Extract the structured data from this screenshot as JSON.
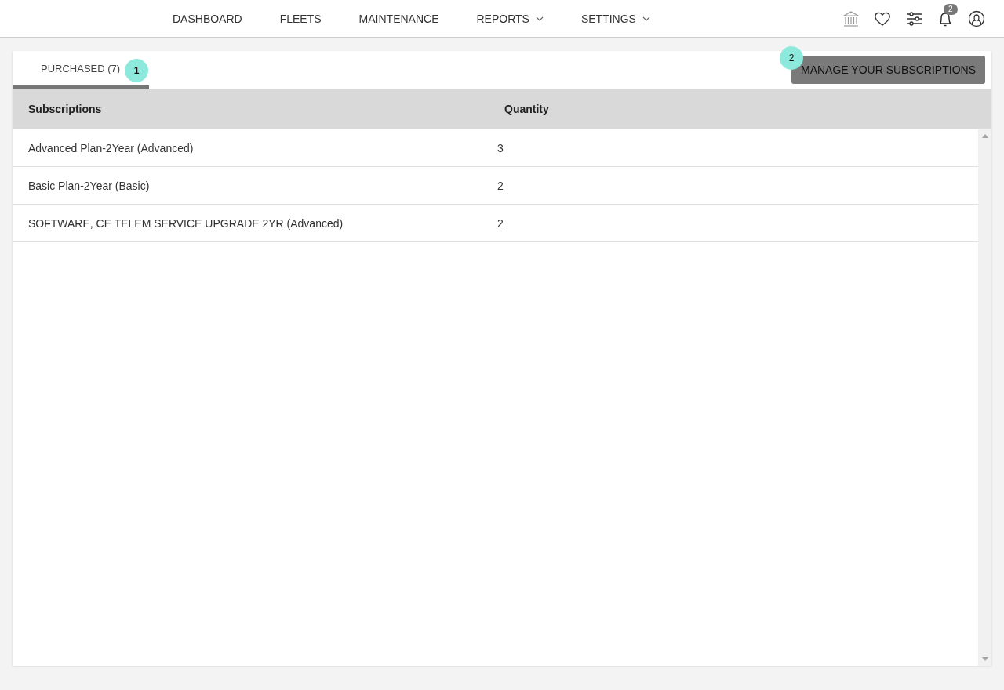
{
  "nav": {
    "items": [
      {
        "label": "DASHBOARD",
        "has_menu": false
      },
      {
        "label": "FLEETS",
        "has_menu": false
      },
      {
        "label": "MAINTENANCE",
        "has_menu": false
      },
      {
        "label": "REPORTS",
        "has_menu": true
      },
      {
        "label": "SETTINGS",
        "has_menu": true
      }
    ],
    "icons": [
      {
        "kind": "building"
      },
      {
        "kind": "heart"
      },
      {
        "kind": "sliders"
      },
      {
        "kind": "bell",
        "badge": "2"
      },
      {
        "kind": "user"
      }
    ]
  },
  "tabs": [
    {
      "label": "PURCHASED (7)",
      "selected": true,
      "marker": "1"
    }
  ],
  "action": {
    "label": "MANAGE YOUR SUBSCRIPTIONS",
    "marker": "2"
  },
  "table": {
    "columns": [
      "Subscriptions",
      "Quantity"
    ],
    "rows": [
      [
        "Advanced Plan-2Year (Advanced)",
        "3"
      ],
      [
        "Basic Plan-2Year (Basic)",
        "2"
      ],
      [
        "SOFTWARE, CE TELEM SERVICE UPGRADE 2YR (Advanced)",
        "2"
      ]
    ]
  }
}
